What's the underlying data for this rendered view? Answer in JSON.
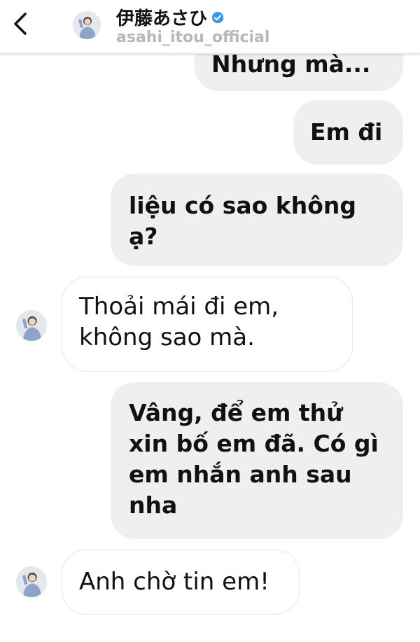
{
  "header": {
    "back_icon": "chevron-left-icon",
    "display_name": "伊藤あさひ",
    "username": "asahi_itou_official",
    "verified_icon": "verified-badge-icon",
    "verified_color": "#3897f0"
  },
  "messages": [
    {
      "from": "me",
      "text": "Nhưng mà..."
    },
    {
      "from": "me",
      "text": "Em đi"
    },
    {
      "from": "me",
      "text": "liệu có sao không ạ?"
    },
    {
      "from": "them",
      "text": "Thoải mái đi em, không sao mà."
    },
    {
      "from": "me",
      "text": "Vâng, để em thử xin bố em đã. Có gì em nhắn anh sau nha"
    },
    {
      "from": "them",
      "text": "Anh chờ tin em!"
    }
  ]
}
